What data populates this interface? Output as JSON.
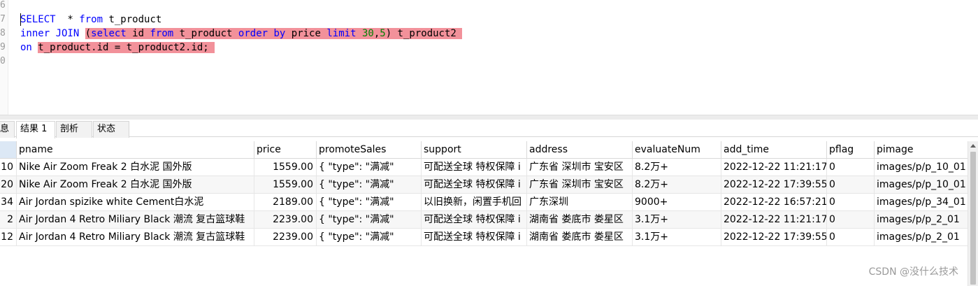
{
  "editor": {
    "line_numbers": [
      "6",
      "7",
      "8",
      "9",
      "0"
    ],
    "lines": [
      [
        {
          "t": "SELECT",
          "c": "kw"
        },
        {
          "t": "  * ",
          "c": ""
        },
        {
          "t": "from",
          "c": "kw"
        },
        {
          "t": " t_product",
          "c": ""
        }
      ],
      [
        {
          "t": "inner JOIN",
          "c": "kw"
        },
        {
          "t": " ",
          "c": ""
        },
        {
          "t": "(",
          "c": "hl"
        },
        {
          "t": "select",
          "c": "kw hl"
        },
        {
          "t": " id ",
          "c": "hl"
        },
        {
          "t": "from",
          "c": "kw hl"
        },
        {
          "t": " t_product ",
          "c": "hl"
        },
        {
          "t": "order by",
          "c": "kw hl"
        },
        {
          "t": " price ",
          "c": "hl"
        },
        {
          "t": "limit",
          "c": "kw hl"
        },
        {
          "t": " ",
          "c": "hl"
        },
        {
          "t": "30",
          "c": "num hl"
        },
        {
          "t": ",",
          "c": "hl"
        },
        {
          "t": "5",
          "c": "num hl"
        },
        {
          "t": ") t_product2 ",
          "c": "hl"
        }
      ],
      [
        {
          "t": "on",
          "c": "kw"
        },
        {
          "t": " ",
          "c": ""
        },
        {
          "t": "t_product.id = t_product2.id; ",
          "c": "hl"
        }
      ]
    ]
  },
  "tabs": [
    "息",
    "结果 1",
    "剖析",
    "状态"
  ],
  "active_tab": 1,
  "grid": {
    "columns": [
      "pname",
      "price",
      "promoteSales",
      "support",
      "address",
      "evaluateNum",
      "add_time",
      "pflag",
      "pimage"
    ],
    "rows": [
      {
        "id": "10",
        "cells": [
          "Nike Air Zoom Freak 2 白水泥 国外版",
          "1559.00",
          "{         \"type\": \"满减\"",
          "可配送全球 特权保障 i",
          "广东省 深圳市 宝安区",
          "8.2万+",
          "2022-12-22 11:21:17",
          "0",
          "images/p/p_10_01"
        ]
      },
      {
        "id": "20",
        "cells": [
          "Nike Air Zoom Freak 2 白水泥 国外版",
          "1559.00",
          "{         \"type\": \"满减\"",
          "可配送全球 特权保障 i",
          "广东省 深圳市 宝安区",
          "8.2万+",
          "2022-12-22 17:39:55",
          "0",
          "images/p/p_10_01"
        ]
      },
      {
        "id": "34",
        "cells": [
          "Air Jordan spizike white Cement白水泥",
          "2189.00",
          "{         \"type\": \"满减\"",
          "以旧换新，闲置手机回",
          "广东深圳",
          "9000+",
          "2022-12-22 16:57:21",
          "0",
          "images/p/p_34_01"
        ]
      },
      {
        "id": "2",
        "cells": [
          "Air Jordan 4 Retro Miliary Black 潮流 复古篮球鞋",
          "2239.00",
          "{         \"type\": \"满减\"",
          "可配送全球 特权保障 i",
          "湖南省 娄底市 娄星区",
          "3.1万+",
          "2022-12-22 11:21:17",
          "0",
          "images/p/p_2_01"
        ]
      },
      {
        "id": "12",
        "cells": [
          "Air Jordan 4 Retro Miliary Black 潮流 复古篮球鞋",
          "2239.00",
          "{         \"type\": \"满减\"",
          "可配送全球 特权保障 i",
          "湖南省 娄底市 娄星区",
          "3.1万+",
          "2022-12-22 17:39:55",
          "0",
          "images/p/p_2_01"
        ]
      }
    ]
  },
  "watermark": "CSDN @没什么技术"
}
